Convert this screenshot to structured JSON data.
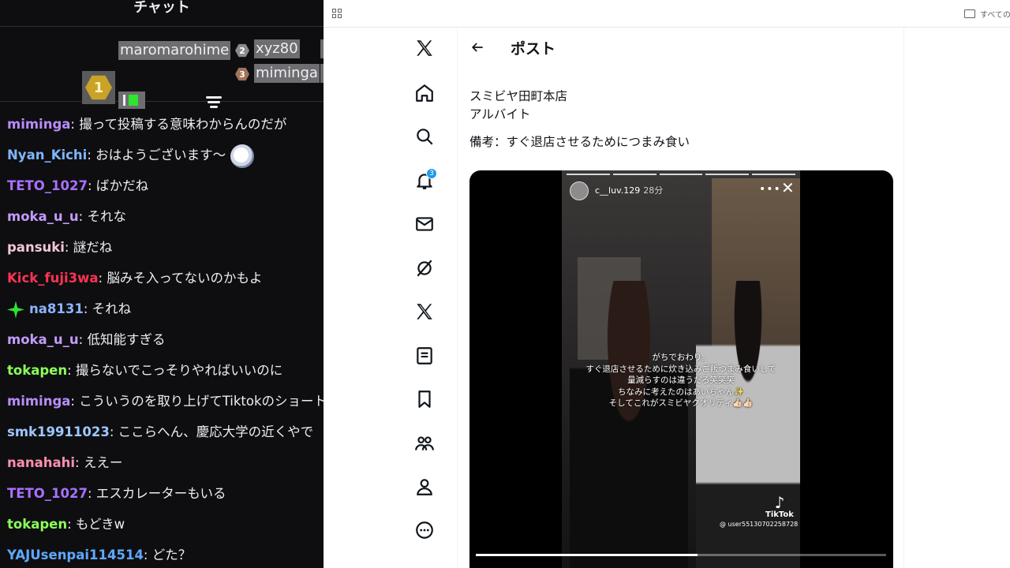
{
  "chat": {
    "title": "チャット",
    "leaderboard": {
      "first": {
        "rank": "1",
        "name": "maromarohime"
      },
      "second": {
        "rank": "2",
        "name": "xyz80"
      },
      "third": {
        "rank": "3",
        "name": "miminga"
      }
    },
    "messages": [
      {
        "user": "miminga",
        "color": "#b98cff",
        "text": "撮って投稿する意味わからんのだが"
      },
      {
        "user": "Nyan_Kichi",
        "color": "#7fb6ff",
        "text": "おはようございます〜",
        "emote": "stamp-emote"
      },
      {
        "user": "TETO_1027",
        "color": "#a970ff",
        "text": "ばかだね"
      },
      {
        "user": "moka_u_u",
        "color": "#c39cff",
        "text": "それな"
      },
      {
        "user": "pansuki",
        "color": "#f2c7d9",
        "text": "謎だね"
      },
      {
        "user": "Kick_fuji3wa",
        "color": "#ff3355",
        "text": "脳みそ入ってないのかもよ"
      },
      {
        "user": "na8131",
        "color": "#8ab4ff",
        "text": "それね",
        "badge": "sparkle-badge"
      },
      {
        "user": "moka_u_u",
        "color": "#c39cff",
        "text": "低知能すぎる"
      },
      {
        "user": "tokapen",
        "color": "#8cff5a",
        "text": "撮らないでこっそりやればいいのに"
      },
      {
        "user": "miminga",
        "color": "#b98cff",
        "text": "こういうのを取り上げてTiktokのショート"
      },
      {
        "user": "smk19911023",
        "color": "#9fc7ff",
        "text": "ここらへん、慶応大学の近くやで"
      },
      {
        "user": "nanahahi",
        "color": "#ff8fb0",
        "text": "ええー"
      },
      {
        "user": "TETO_1027",
        "color": "#a970ff",
        "text": "エスカレーターもいる"
      },
      {
        "user": "tokapen",
        "color": "#8cff5a",
        "text": "もどきw"
      },
      {
        "user": "YAJUsenpai114514",
        "color": "#5fa8ff",
        "text": "どた？"
      }
    ]
  },
  "browser": {
    "bookmark_folder": "すべてのブ"
  },
  "x": {
    "notif_count": "3",
    "post_title": "ポスト",
    "post_lines": [
      "スミビヤ田町本店",
      "アルバイト",
      "備考：すぐ退店させるためにつまみ食い"
    ],
    "story": {
      "user": "c__luv.129",
      "time": "28分",
      "overlay_lines": [
        "がちでおわり。",
        "すぐ退店させるために炊き込みご飯つまみ食いして",
        "量減らすのは違うだろ笑笑笑",
        "ちなみに考えたのはあいちゃん✨",
        "そしてこれがスミビヤクオリティ👍🏻👍🏻"
      ],
      "tiktok_label": "TikTok",
      "tiktok_user": "@ user55130702258728",
      "progress": 0.54
    }
  }
}
